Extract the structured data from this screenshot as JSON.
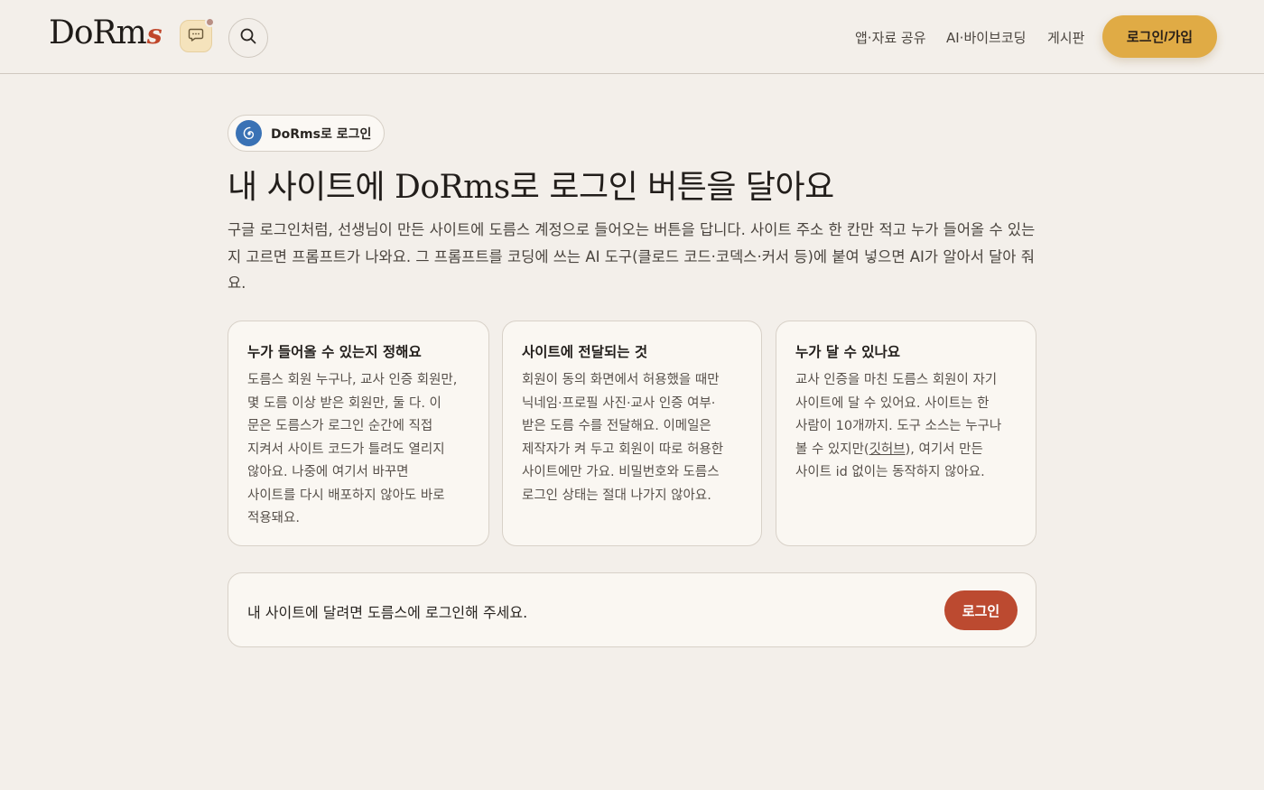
{
  "header": {
    "logo_text": "DoRm",
    "logo_accent": "s",
    "nav": [
      "앱·자료 공유",
      "AI·바이브코딩",
      "게시판"
    ],
    "login_label": "로그인/가입"
  },
  "badge": {
    "label": "DoRms로 로그인"
  },
  "hero": {
    "title_a": "내 사이트에 ",
    "title_brand": "DoRms",
    "title_b": "로 로그인 버튼을 달아요",
    "description": "구글 로그인처럼, 선생님이 만든 사이트에 도름스 계정으로 들어오는 버튼을 답니다. 사이트 주소 한 칸만 적고 누가 들어올 수 있는지 고르면 프롬프트가 나와요. 그 프롬프트를 코딩에 쓰는 AI 도구(클로드 코드·코덱스·커서 등)에 붙여 넣으면 AI가 알아서 달아 줘요."
  },
  "cards": [
    {
      "title": "누가 들어올 수 있는지 정해요",
      "lines": [
        "도름스 회원 누구나, 교사 인증 회원만,",
        "몇 도름 이상 받은 회원만, 둘 다. 이",
        "문은 도름스가 로그인 순간에 직접",
        "지켜서 사이트 코드가 틀려도 열리지",
        "않아요. 나중에 여기서 바꾸면",
        "사이트를 다시 배포하지 않아도 바로",
        "적용돼요."
      ]
    },
    {
      "title": "사이트에 전달되는 것",
      "lines": [
        "회원이 동의 화면에서 허용했을 때만",
        "닉네임·프로필 사진·교사 인증 여부·",
        "받은 도름 수를 전달해요. 이메일은",
        "제작자가 켜 두고 회원이 따로 허용한",
        "사이트에만 가요. 비밀번호와 도름스",
        "로그인 상태는 절대 나가지 않아요."
      ]
    },
    {
      "title": "누가 달 수 있나요",
      "lines": [
        "교사 인증을 마친 도름스 회원이 자기",
        "사이트에 달 수 있어요. 사이트는 한",
        "사람이 10개까지. 도구 소스는 누구나"
      ],
      "line4_a": "볼 수 있지만(",
      "line4_link": "깃허브",
      "line4_b": "), 여기서 만든",
      "line5": "사이트 id 없이는 동작하지 않아요."
    }
  ],
  "cta": {
    "text": "내 사이트에 달려면 도름스에 로그인해 주세요.",
    "button": "로그인"
  },
  "colors": {
    "background": "#f3efea",
    "accent_yellow": "#e0ab45",
    "accent_red": "#bc4a30",
    "badge_blue": "#3a72b5"
  }
}
